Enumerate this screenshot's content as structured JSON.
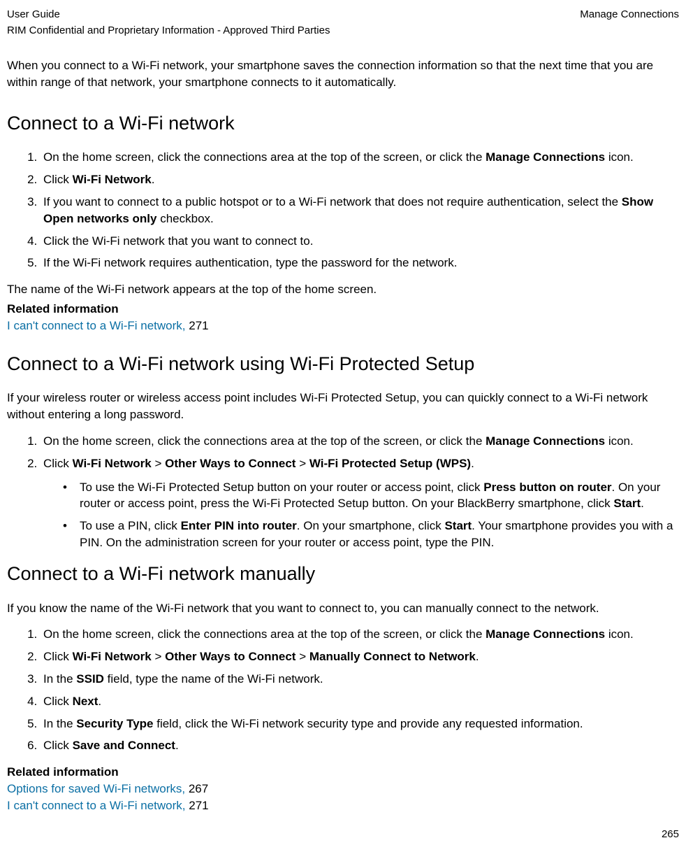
{
  "header": {
    "left": "User Guide",
    "right": "Manage Connections",
    "sub": "RIM Confidential and Proprietary Information - Approved Third Parties"
  },
  "intro": "When you connect to a Wi-Fi network, your smartphone saves the connection information so that the next time that you are within range of that network, your smartphone connects to it automatically.",
  "s1": {
    "title": "Connect to a Wi-Fi network",
    "step1a": "On the home screen, click the connections area at the top of the screen, or click the ",
    "step1b": "Manage Connections",
    "step1c": " icon.",
    "step2a": "Click ",
    "step2b": "Wi-Fi Network",
    "step2c": ".",
    "step3a": "If you want to connect to a public hotspot or to a Wi-Fi network that does not require authentication, select the ",
    "step3b": "Show Open networks only",
    "step3c": " checkbox.",
    "step4": "Click the Wi-Fi network that you want to connect to.",
    "step5": "If the Wi-Fi network requires authentication, type the password for the network.",
    "after": "The name of the Wi-Fi network appears at the top of the home screen.",
    "relHeading": "Related information",
    "link1a": "I can't connect to a Wi-Fi network, ",
    "link1b": "271"
  },
  "s2": {
    "title": "Connect to a Wi-Fi network using Wi-Fi Protected Setup",
    "intro": "If your wireless router or wireless access point includes Wi-Fi Protected Setup, you can quickly connect to a Wi-Fi network without entering a long password.",
    "step1a": "On the home screen, click the connections area at the top of the screen, or click the ",
    "step1b": "Manage Connections",
    "step1c": " icon.",
    "step2a": "Click ",
    "step2b": "Wi-Fi Network",
    "step2c": " > ",
    "step2d": "Other Ways to Connect",
    "step2e": " > ",
    "step2f": "Wi-Fi Protected Setup (WPS)",
    "step2g": ".",
    "b1a": "To use the Wi-Fi Protected Setup button on your router or access point, click ",
    "b1b": "Press button on router",
    "b1c": ". On your router or access point, press the Wi-Fi Protected Setup button. On your BlackBerry smartphone, click ",
    "b1d": "Start",
    "b1e": ".",
    "b2a": "To use a PIN, click ",
    "b2b": "Enter PIN into router",
    "b2c": ". On your smartphone, click ",
    "b2d": "Start",
    "b2e": ". Your smartphone provides you with a PIN. On the administration screen for your router or access point, type the PIN."
  },
  "s3": {
    "title": "Connect to a Wi-Fi network manually",
    "intro": "If you know the name of the Wi-Fi network that you want to connect to, you can manually connect to the network.",
    "step1a": "On the home screen, click the connections area at the top of the screen, or click the ",
    "step1b": "Manage Connections",
    "step1c": " icon.",
    "step2a": "Click ",
    "step2b": "Wi-Fi Network",
    "step2c": " > ",
    "step2d": "Other Ways to Connect",
    "step2e": " > ",
    "step2f": "Manually Connect to Network",
    "step2g": ".",
    "step3a": "In the ",
    "step3b": "SSID",
    "step3c": " field, type the name of the Wi-Fi network.",
    "step4a": "Click ",
    "step4b": "Next",
    "step4c": ".",
    "step5a": "In the ",
    "step5b": "Security Type",
    "step5c": " field, click the Wi-Fi network security type and provide any requested information.",
    "step6a": "Click ",
    "step6b": "Save and Connect",
    "step6c": ".",
    "relHeading": "Related information",
    "link1a": "Options for saved Wi-Fi networks, ",
    "link1b": "267",
    "link2a": "I can't connect to a Wi-Fi network, ",
    "link2b": "271"
  },
  "pageNum": "265"
}
